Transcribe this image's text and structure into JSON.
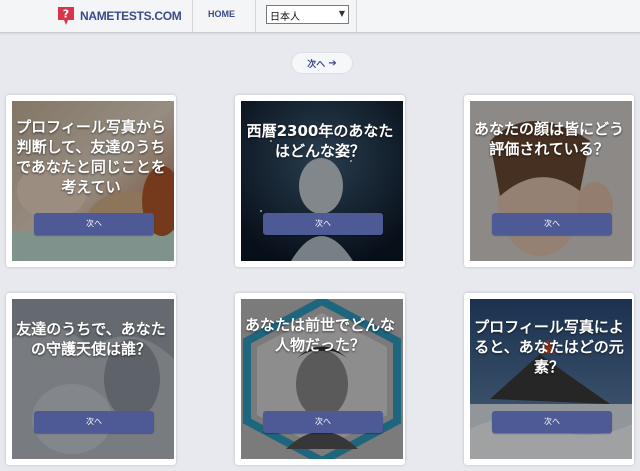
{
  "header": {
    "logo_text": "NAMETESTS.COM",
    "nav_home": "HOME",
    "language_selected": "日本人"
  },
  "top_next": {
    "label": "次へ",
    "arrow": "➔"
  },
  "cards": [
    {
      "title": "プロフィール写真から判断して、友達のうちであなたと同じことを考えてい",
      "button": "次へ"
    },
    {
      "title": "西暦2300年のあなたはどんな姿？",
      "button": "次へ"
    },
    {
      "title": "あなたの顔は皆にどう評価されている？",
      "button": "次へ"
    },
    {
      "title": "友達のうちで、あなたの守護天使は誰？",
      "button": "次へ"
    },
    {
      "title": "あなたは前世でどんな人物だった？",
      "button": "次へ"
    },
    {
      "title": "プロフィール写真によると、あなたはどの元素？",
      "button": "次へ"
    }
  ],
  "colors": {
    "brand": "#3b4a8a",
    "button": "#4d5a95",
    "page_bg": "#e7e9ee"
  }
}
